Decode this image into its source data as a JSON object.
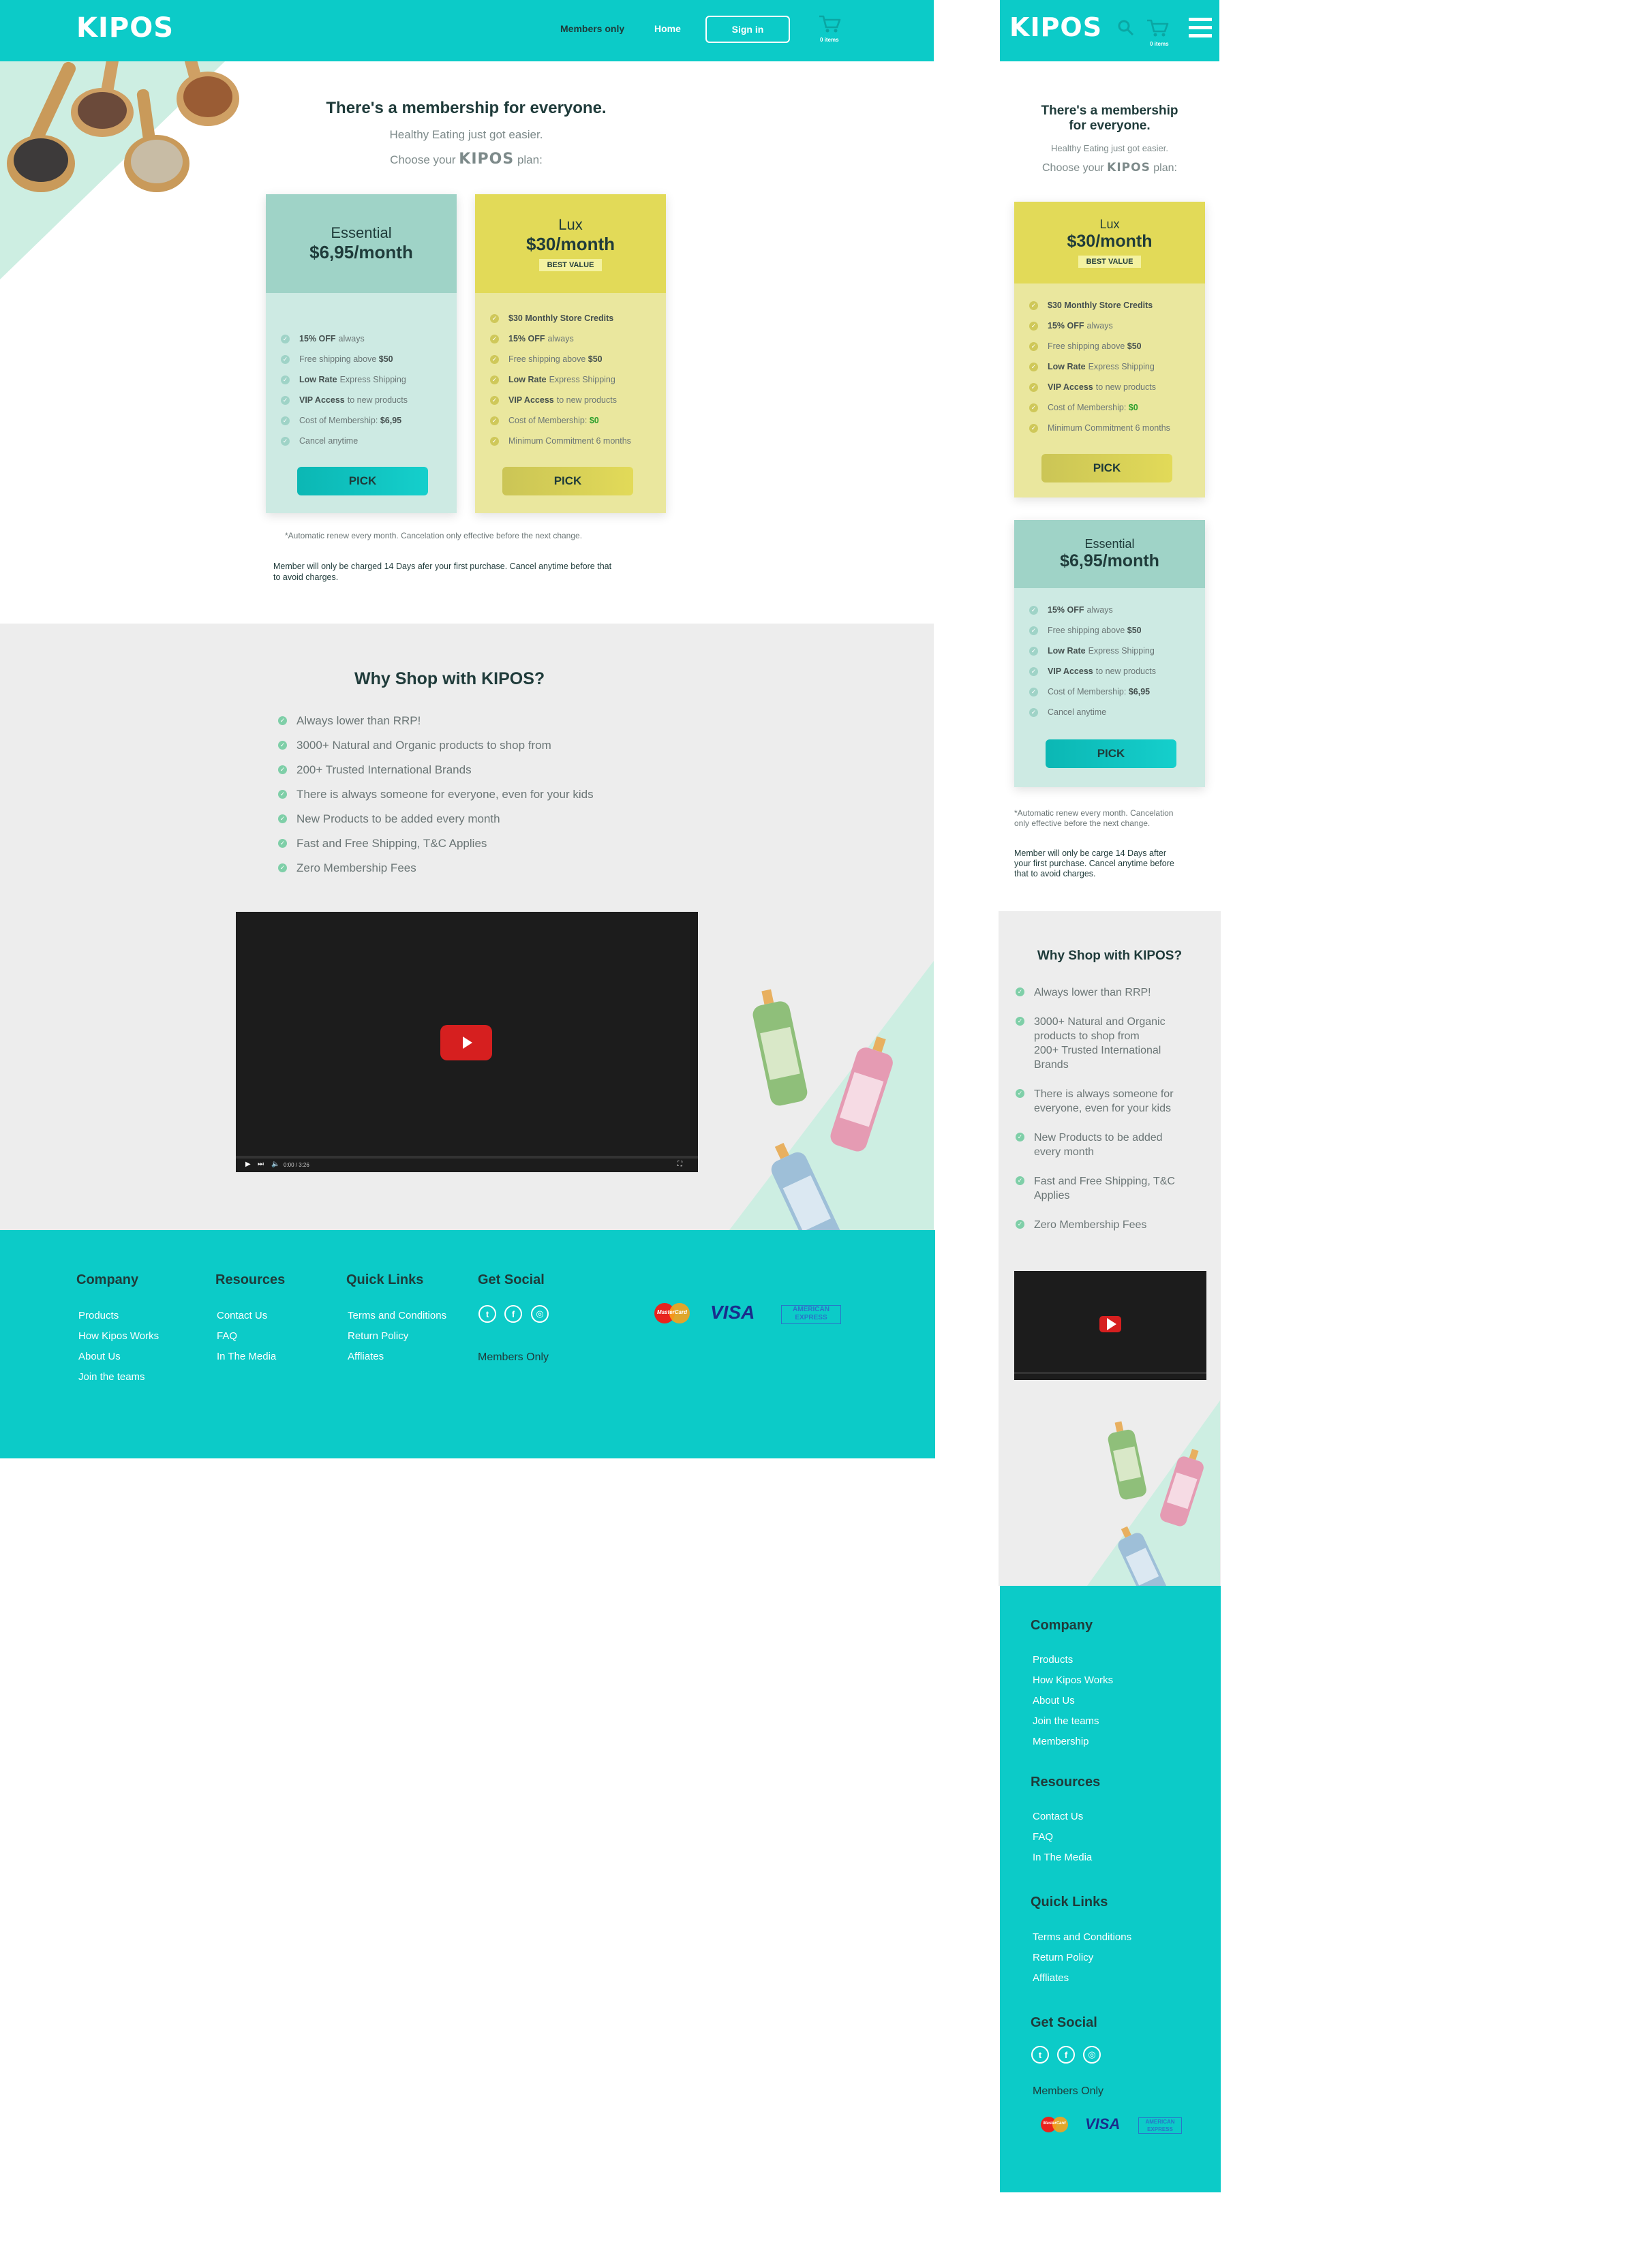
{
  "brand": {
    "logo": "KIPOS",
    "accent": "#0ccbc8"
  },
  "header": {
    "members_only": "Members only",
    "home": "Home",
    "sign_in": "Sign in",
    "cart_items": "0 items"
  },
  "hero": {
    "title": "There's a membership for everyone.",
    "mobile_title_line1": "There's a membership",
    "mobile_title_line2": "for everyone.",
    "subtitle": "Healthy Eating just got easier.",
    "choose_prefix": "Choose your",
    "choose_brand": "KIPOS",
    "choose_suffix": "plan:"
  },
  "plans": {
    "essential": {
      "name": "Essential",
      "price": "$6,95/month",
      "pick": "PICK",
      "features": [
        {
          "bold": "15% OFF",
          "text": "always"
        },
        {
          "bold": "",
          "text": "Free shipping above",
          "tail": "$50"
        },
        {
          "bold": "Low Rate",
          "text": "Express Shipping"
        },
        {
          "bold": "VIP Access",
          "text": "to new products"
        },
        {
          "bold": "",
          "text": "Cost of Membership:",
          "tail": "$6,95"
        },
        {
          "bold": "",
          "text": "Cancel anytime"
        }
      ]
    },
    "lux": {
      "name": "Lux",
      "price": "$30/month",
      "badge": "BEST VALUE",
      "pick": "PICK",
      "features": [
        {
          "bold": "$30 Monthly Store Credits",
          "text": ""
        },
        {
          "bold": "15% OFF",
          "text": "always"
        },
        {
          "bold": "",
          "text": "Free shipping above",
          "tail": "$50"
        },
        {
          "bold": "Low Rate",
          "text": "Express Shipping"
        },
        {
          "bold": "VIP Access",
          "text": "to new products"
        },
        {
          "bold": "",
          "text": "Cost of Membership:",
          "tail": "$0"
        },
        {
          "bold": "",
          "text": "Minimum Commitment 6 months"
        }
      ]
    }
  },
  "notes": {
    "auto_renew": "*Automatic renew every month. Cancelation only effective before the next change.",
    "mobile_auto_renew_1": "*Automatic renew every month. Cancelation",
    "mobile_auto_renew_2": "only effective before the next change.",
    "charge_1": "Member will only be charged 14 Days afer your first purchase. Cancel anytime before that",
    "charge_2": "to avoid charges.",
    "mobile_charge_1": "Member will only be carge 14 Days after",
    "mobile_charge_2": "your first purchase. Cancel anytime before",
    "mobile_charge_3": "that to avoid charges."
  },
  "why": {
    "title": "Why Shop with KIPOS?",
    "items": [
      "Always lower than RRP!",
      "3000+ Natural and Organic products to shop from",
      "200+ Trusted International Brands",
      "There is always someone for everyone, even for your kids",
      "New Products to be added every month",
      "Fast and Free Shipping, T&C Applies",
      "Zero Membership Fees"
    ],
    "mobile_items": [
      [
        "Always lower than RRP!"
      ],
      [
        "3000+ Natural and Organic",
        "products to shop from",
        "200+ Trusted International",
        "Brands"
      ],
      [
        "There is always someone for",
        "everyone, even for your kids"
      ],
      [
        "New Products to be added",
        "every month"
      ],
      [
        "Fast and Free Shipping, T&C",
        "Applies"
      ],
      [
        "Zero Membership Fees"
      ]
    ]
  },
  "video": {
    "time": "0:00 / 3:26"
  },
  "footer": {
    "company": {
      "title": "Company",
      "links": [
        "Products",
        "How Kipos Works",
        "About Us",
        "Join the teams"
      ],
      "mobile_links": [
        "Products",
        "How Kipos Works",
        "About Us",
        "Join the teams",
        "Membership"
      ]
    },
    "resources": {
      "title": "Resources",
      "links": [
        "Contact Us",
        "FAQ",
        "In The Media"
      ]
    },
    "quick": {
      "title": "Quick Links",
      "links": [
        "Terms and Conditions",
        "Return Policy",
        "Affliates"
      ]
    },
    "social": {
      "title": "Get Social",
      "members_only": "Members Only"
    },
    "payments": {
      "mastercard": "MasterCard",
      "visa": "VISA",
      "amex_1": "AMERICAN",
      "amex_2": "EXPRESS"
    }
  }
}
